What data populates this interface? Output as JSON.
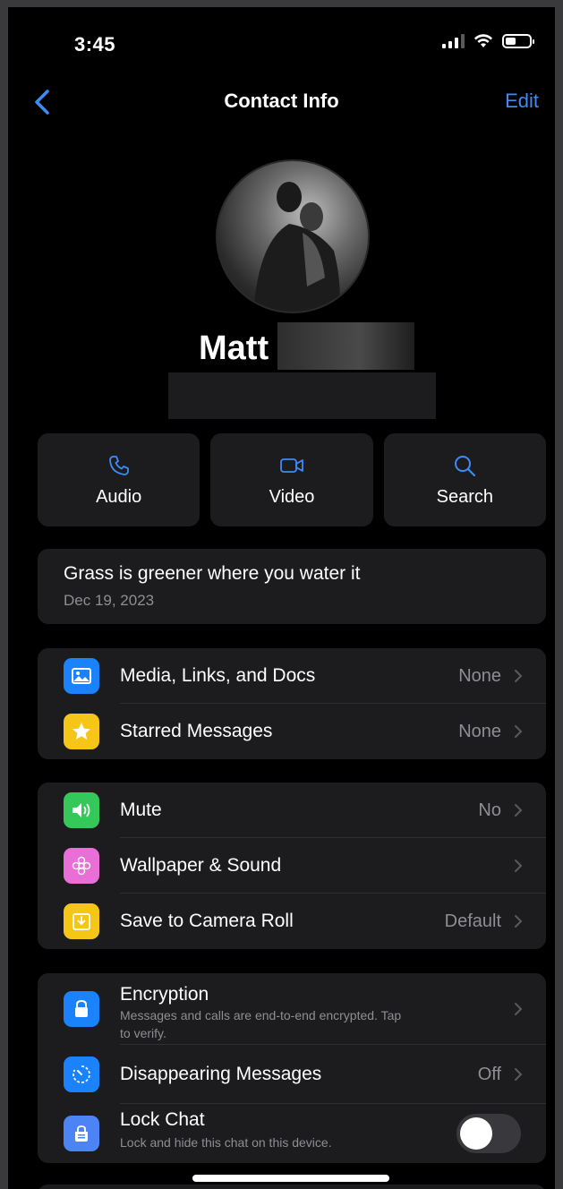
{
  "status_bar": {
    "time": "3:45"
  },
  "nav": {
    "title": "Contact Info",
    "edit_label": "Edit"
  },
  "contact": {
    "name": "Matt"
  },
  "actions": [
    {
      "label": "Audio",
      "icon": "phone-icon"
    },
    {
      "label": "Video",
      "icon": "video-icon"
    },
    {
      "label": "Search",
      "icon": "search-icon"
    }
  ],
  "about": {
    "text": "Grass is greener where you water it",
    "date": "Dec 19, 2023"
  },
  "group1": [
    {
      "label": "Media, Links, and Docs",
      "value": "None",
      "icon": "photo-icon",
      "color": "#1a82fb"
    },
    {
      "label": "Starred Messages",
      "value": "None",
      "icon": "star-icon",
      "color": "#f5c518"
    }
  ],
  "group2": [
    {
      "label": "Mute",
      "value": "No",
      "icon": "speaker-icon",
      "color": "#34c759"
    },
    {
      "label": "Wallpaper & Sound",
      "value": "",
      "icon": "flower-icon",
      "color": "#e96ed5"
    },
    {
      "label": "Save to Camera Roll",
      "value": "Default",
      "icon": "download-icon",
      "color": "#f5c518"
    }
  ],
  "group3": {
    "encryption": {
      "label": "Encryption",
      "subtitle_line1": "Messages and calls are end-to-end encrypted. Tap",
      "subtitle_line2": "to verify.",
      "icon": "lock-icon",
      "color": "#1a82fb"
    },
    "disappearing": {
      "label": "Disappearing Messages",
      "value": "Off",
      "icon": "timer-icon",
      "color": "#1a82fb"
    },
    "lock_chat": {
      "label": "Lock Chat",
      "subtitle": "Lock and hide this chat on this device.",
      "icon": "lock-chat-icon",
      "color": "#4c84f6",
      "enabled": false
    }
  },
  "colors": {
    "accent": "#3d8bf5",
    "card": "#1c1c1e",
    "secondary_text": "#8e8e93"
  }
}
